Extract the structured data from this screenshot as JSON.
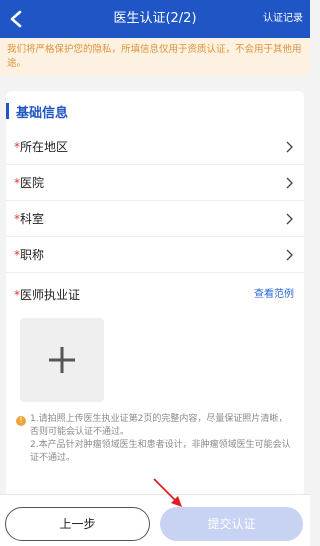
{
  "header": {
    "title": "医生认证(2/2)",
    "right_link": "认证记录"
  },
  "notice": "我们将严格保护您的隐私，所填信息仅用于资质认证，不会用于其他用途。",
  "section": {
    "title": "基础信息"
  },
  "fields": [
    {
      "required": "*",
      "label": "所在地区"
    },
    {
      "required": "*",
      "label": "医院"
    },
    {
      "required": "*",
      "label": "科室"
    },
    {
      "required": "*",
      "label": "职称"
    }
  ],
  "license": {
    "required": "*",
    "label": "医师执业证",
    "sample_link": "查看范例"
  },
  "tips": {
    "line1": "1.请拍照上传医生执业证第2页的完整内容，尽量保证照片清晰，否则可能会认证不通过。",
    "line2": "2.本产品针对肿瘤领域医生和患者设计，非肿瘤领域医生可能会认证不通过。"
  },
  "buttons": {
    "prev": "上一步",
    "submit": "提交认证"
  },
  "colors": {
    "primary": "#1f55c5",
    "notice_bg": "#fdf2e2",
    "notice_text": "#e0923a",
    "required": "#e03a3a",
    "submit_disabled": "#c8d2f2",
    "annotation_arrow": "#e02020"
  }
}
